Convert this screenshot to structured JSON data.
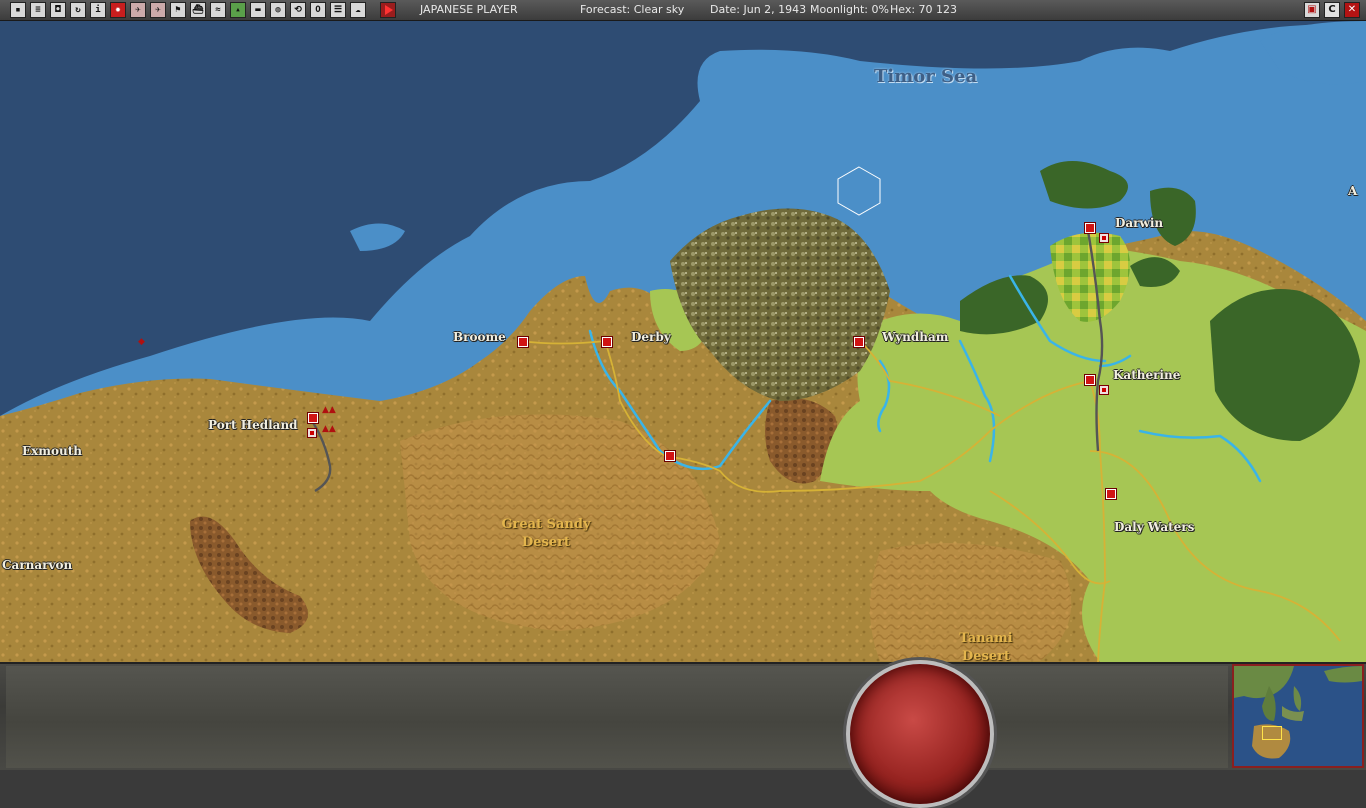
{
  "toolbar": {
    "player": "JAPANESE PLAYER",
    "forecast": "Forecast: Clear sky",
    "date": "Date: Jun 2, 1943",
    "moonlight": "Moonlight: 0%",
    "hex": "Hex: 70 123",
    "icons": [
      "save-icon",
      "report-icon",
      "replay-icon",
      "refresh-icon",
      "info-icon",
      "japan-flag-icon",
      "fighter-icon",
      "bomber-icon",
      "flag-icon",
      "ship-icon",
      "logistics-icon",
      "terrain-icon",
      "convoy-icon",
      "globe-icon",
      "cycle-icon",
      "op-icon",
      "list-icon",
      "cloud-icon",
      "end-turn-icon"
    ],
    "right_icons": [
      "map-icon",
      "c-icon",
      "close-icon"
    ],
    "right_labels": [
      "C"
    ]
  },
  "map": {
    "sea_label": "Timor Sea",
    "places": {
      "broome": "Broome",
      "derby": "Derby",
      "wyndham": "Wyndham",
      "darwin": "Darwin",
      "katherine": "Katherine",
      "daly_waters": "Daly Waters",
      "port_hedland": "Port Hedland",
      "exmouth": "Exmouth",
      "carnarvon": "Carnarvon",
      "edge_label": "A"
    },
    "regions": {
      "great_sandy": "Great Sandy Desert",
      "tanami": "Tanami Desert"
    },
    "colors": {
      "deep_sea": "#2e4c73",
      "shallow_sea": "#4d90c9",
      "desert": "#ad8a3e",
      "grassland": "#a8c656",
      "forest": "#3d6b2a",
      "base_red": "#d01414"
    }
  },
  "bottom": {
    "turn_button": "end-turn-button",
    "minimap": "minimap"
  }
}
